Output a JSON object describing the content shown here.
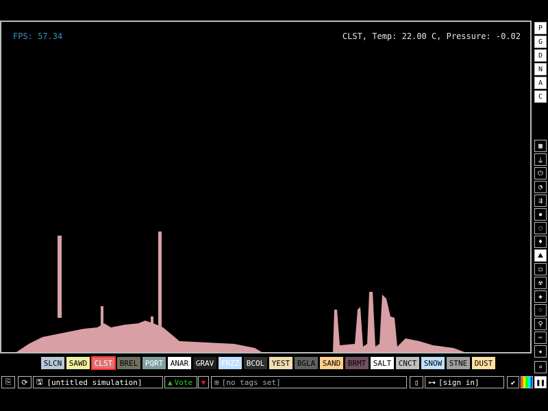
{
  "hud": {
    "fps_text": "FPS: 57.34",
    "cursor_info": "CLST, Temp: 22.00 C, Pressure: -0.02"
  },
  "right_toolbar": {
    "top": [
      "P",
      "G",
      "D",
      "N",
      "A",
      "C"
    ],
    "menu_icons": [
      "wall-icon",
      "electronics-icon",
      "power-icon",
      "sensor-icon",
      "force-icon",
      "explosives-icon",
      "gas-icon",
      "liquid-icon",
      "powder-icon",
      "solid-icon",
      "radioactive-icon",
      "special-icon",
      "particles-icon",
      "life-icon",
      "tools-icon",
      "favorites-icon"
    ]
  },
  "elements": [
    {
      "label": "SLCN",
      "bg": "#b8c8d8",
      "fg": "#000"
    },
    {
      "label": "SAWD",
      "bg": "#f0f0a0",
      "fg": "#000"
    },
    {
      "label": "CLST",
      "bg": "#e07070",
      "fg": "#fff",
      "selected": true
    },
    {
      "label": "BREL",
      "bg": "#707060",
      "fg": "#000"
    },
    {
      "label": "PQRT",
      "bg": "#80a0a0",
      "fg": "#fff"
    },
    {
      "label": "ANAR",
      "bg": "#ffffff",
      "fg": "#000"
    },
    {
      "label": "GRAV",
      "bg": "#202020",
      "fg": "#fff"
    },
    {
      "label": "FRZZ",
      "bg": "#c0e0ff",
      "fg": "#fff"
    },
    {
      "label": "BCOL",
      "bg": "#303030",
      "fg": "#fff"
    },
    {
      "label": "YEST",
      "bg": "#f0e0b0",
      "fg": "#000"
    },
    {
      "label": "BGLA",
      "bg": "#606060",
      "fg": "#000"
    },
    {
      "label": "SAND",
      "bg": "#ffd090",
      "fg": "#000"
    },
    {
      "label": "BRMT",
      "bg": "#705060",
      "fg": "#000"
    },
    {
      "label": "SALT",
      "bg": "#ffffff",
      "fg": "#000"
    },
    {
      "label": "CNCT",
      "bg": "#c0c0c0",
      "fg": "#000"
    },
    {
      "label": "SNOW",
      "bg": "#c0e0ff",
      "fg": "#000"
    },
    {
      "label": "STNE",
      "bg": "#a0a0a0",
      "fg": "#000"
    },
    {
      "label": "DUST",
      "bg": "#ffe0a0",
      "fg": "#000"
    }
  ],
  "bottom_bar": {
    "title": "[untitled simulation]",
    "vote": "Vote",
    "tags": "[no tags set]",
    "sign_in": "[sign in]"
  },
  "colors": {
    "particle": "#d8a0a4",
    "fps": "#3f8fbf"
  }
}
